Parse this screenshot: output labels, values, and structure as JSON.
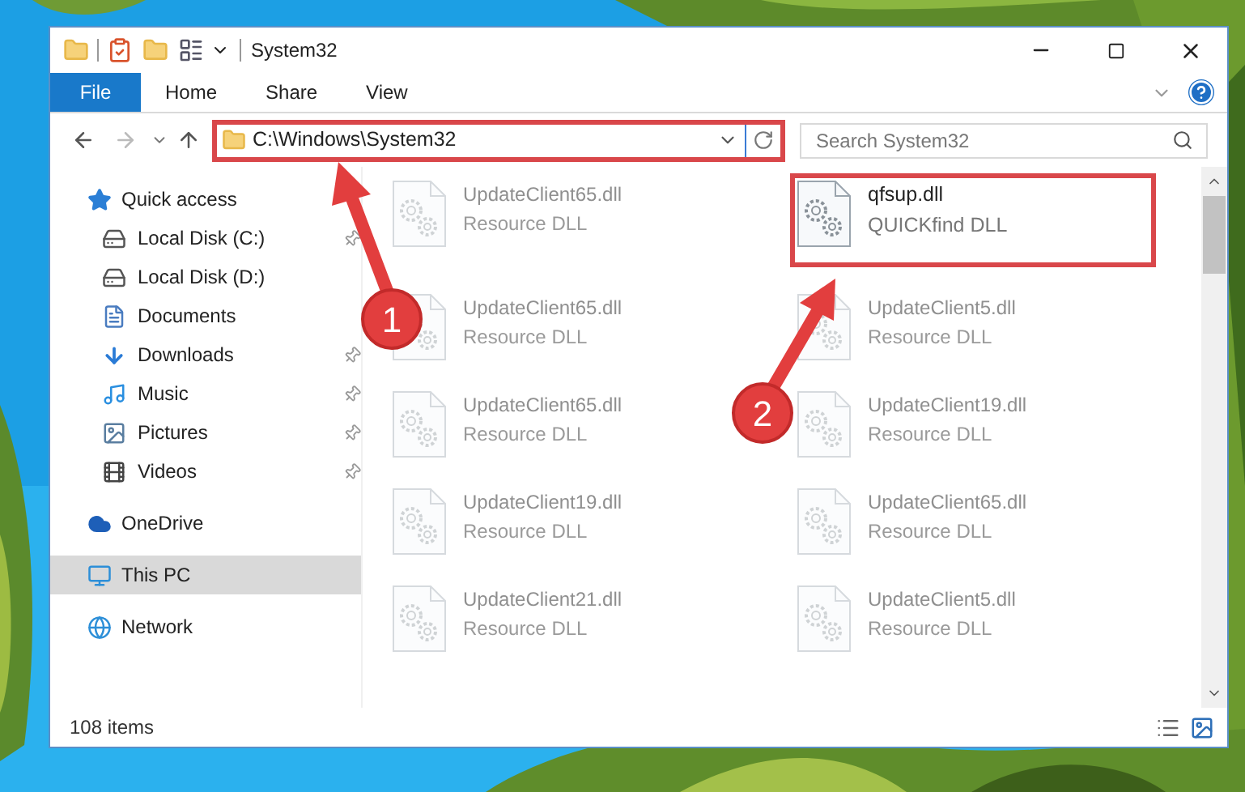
{
  "window": {
    "title": "System32"
  },
  "ribbon_tabs": [
    {
      "label": "File",
      "selected": true
    },
    {
      "label": "Home",
      "selected": false
    },
    {
      "label": "Share",
      "selected": false
    },
    {
      "label": "View",
      "selected": false
    }
  ],
  "address_bar": {
    "value": "C:\\Windows\\System32",
    "highlighted": true
  },
  "search": {
    "placeholder": "Search System32"
  },
  "sidebar": {
    "items": [
      {
        "label": "Quick access",
        "kind": "star",
        "selected": false,
        "children": [
          {
            "label": "Local Disk (C:)",
            "kind": "disk-c",
            "pinned": true
          },
          {
            "label": "Local Disk (D:)",
            "kind": "disk",
            "pinned": false
          },
          {
            "label": "Documents",
            "kind": "documents",
            "pinned": false
          },
          {
            "label": "Downloads",
            "kind": "downloads",
            "pinned": true
          },
          {
            "label": "Music",
            "kind": "music",
            "pinned": true
          },
          {
            "label": "Pictures",
            "kind": "pictures",
            "pinned": true
          },
          {
            "label": "Videos",
            "kind": "videos",
            "pinned": true
          }
        ]
      },
      {
        "label": "OneDrive",
        "kind": "cloud",
        "selected": false
      },
      {
        "label": "This PC",
        "kind": "pc",
        "selected": true
      },
      {
        "label": "Network",
        "kind": "network",
        "selected": false
      }
    ]
  },
  "files": [
    {
      "name": "UpdateClient65.dll",
      "type": "Resource DLL",
      "blurred": true,
      "highlighted": false
    },
    {
      "name": "qfsup.dll",
      "type": "QUICKfind DLL",
      "blurred": false,
      "highlighted": true
    },
    {
      "name": "UpdateClient65.dll",
      "type": "Resource DLL",
      "blurred": true,
      "highlighted": false
    },
    {
      "name": "UpdateClient5.dll",
      "type": "Resource DLL",
      "blurred": true,
      "highlighted": false
    },
    {
      "name": "UpdateClient65.dll",
      "type": "Resource DLL",
      "blurred": true,
      "highlighted": false
    },
    {
      "name": "UpdateClient19.dll",
      "type": "Resource DLL",
      "blurred": true,
      "highlighted": false
    },
    {
      "name": "UpdateClient19.dll",
      "type": "Resource DLL",
      "blurred": true,
      "highlighted": false
    },
    {
      "name": "UpdateClient65.dll",
      "type": "Resource DLL",
      "blurred": true,
      "highlighted": false
    },
    {
      "name": "UpdateClient21.dll",
      "type": "Resource DLL",
      "blurred": true,
      "highlighted": false
    },
    {
      "name": "UpdateClient5.dll",
      "type": "Resource DLL",
      "blurred": true,
      "highlighted": false
    }
  ],
  "status_bar": {
    "item_count": "108 items"
  },
  "annotations": [
    {
      "label": "1"
    },
    {
      "label": "2"
    }
  ]
}
